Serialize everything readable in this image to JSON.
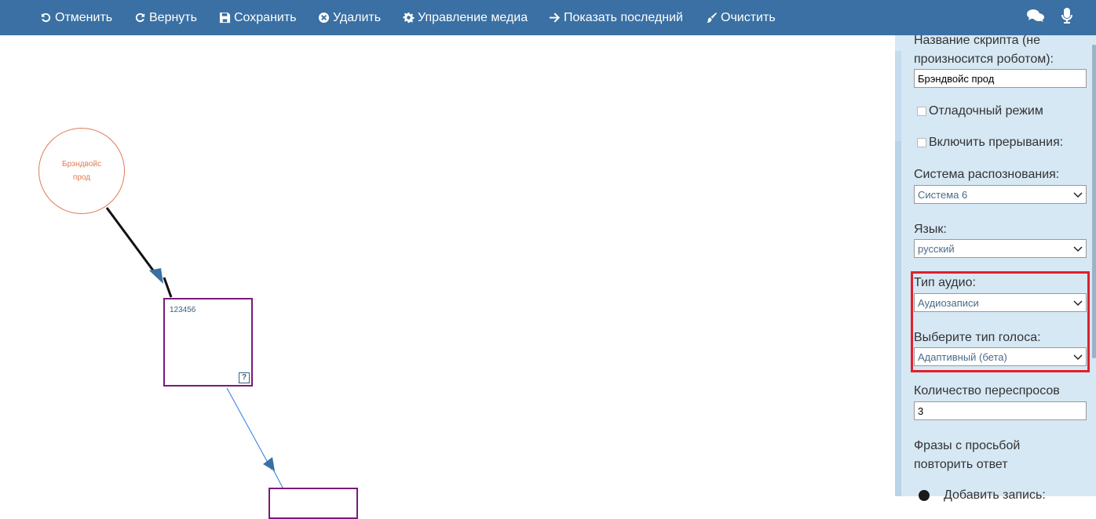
{
  "toolbar": {
    "undo": "Отменить",
    "redo": "Вернуть",
    "save": "Сохранить",
    "delete": "Удалить",
    "media": "Управление медиа",
    "show_last": "Показать последний",
    "clear": "Очистить",
    "color": "#3a70a3"
  },
  "canvas": {
    "start_node": "Брэндвойс прод",
    "block_1": {
      "title": "123456",
      "help": "?"
    }
  },
  "panel": {
    "script_name_label": "Название скрипта (не произносится роботом):",
    "script_name_value": "Брэндвойс прод",
    "debug_label": "Отладочный режим",
    "interrupt_label": "Включить прерывания:",
    "recognition_label": "Система распознования:",
    "recognition_value": "Система 6",
    "language_label": "Язык:",
    "language_value": "русский",
    "audio_type_label": "Тип аудио:",
    "audio_type_value": "Аудиозаписи",
    "voice_type_label": "Выберите тип голоса:",
    "voice_type_value": "Адаптивный (бета)",
    "reprompt_label": "Количество переспросов",
    "reprompt_value": "3",
    "phrases_label": "Фразы с просьбой повторить ответ",
    "add_record": "Добавить запись:"
  }
}
